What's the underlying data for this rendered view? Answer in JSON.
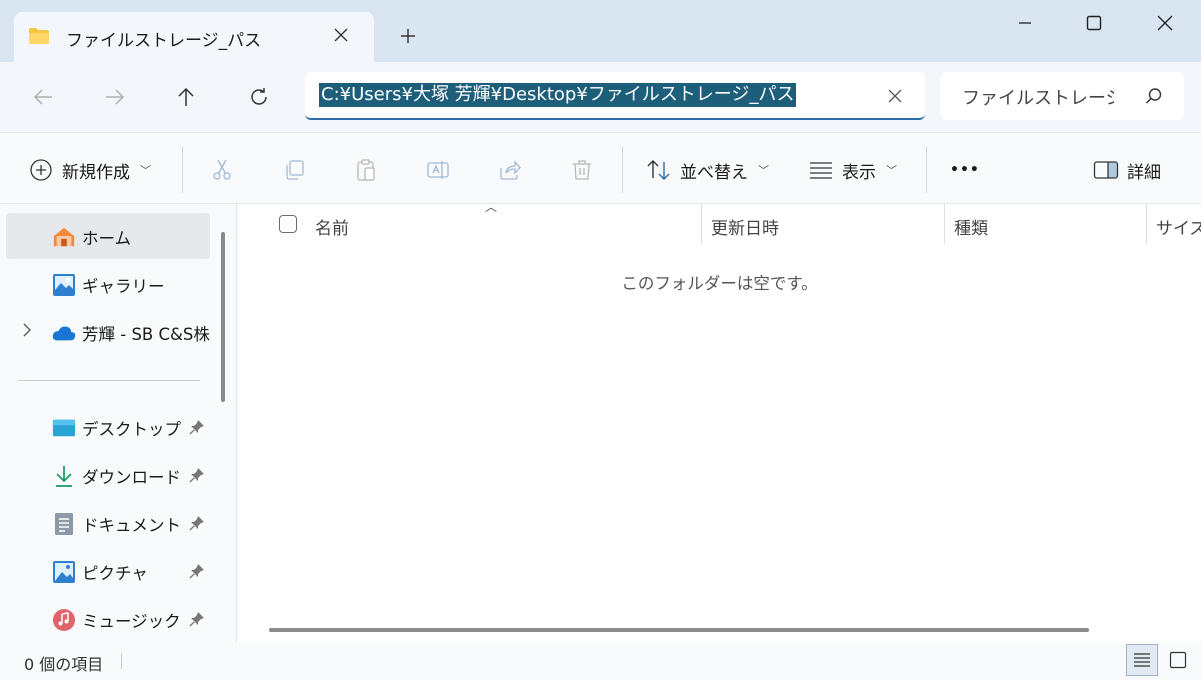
{
  "tab": {
    "title": "ファイルストレージ_パス",
    "folder_icon": "folder-icon",
    "close_icon": "close-icon"
  },
  "new_tab": {
    "icon": "plus-icon"
  },
  "window_controls": {
    "minimize": "minimize-icon",
    "maximize": "maximize-icon",
    "close": "close-icon"
  },
  "nav": {
    "back": "arrow-left-icon",
    "forward": "arrow-right-icon",
    "up": "arrow-up-icon",
    "refresh": "refresh-icon"
  },
  "address": {
    "value": "C:¥Users¥大塚 芳輝¥Desktop¥ファイルストレージ_パス"
  },
  "search": {
    "placeholder": "ファイルストレージ_パ"
  },
  "toolbar": {
    "new_label": "新規作成",
    "sort_label": "並べ替え",
    "view_label": "表示",
    "more_label": "•••",
    "details_label": "詳細"
  },
  "sidebar": {
    "items": [
      {
        "label": "ホーム",
        "icon": "home-icon"
      },
      {
        "label": "ギャラリー",
        "icon": "gallery-icon"
      },
      {
        "label": "芳輝 - SB C&S株",
        "icon": "onedrive-cloud-icon"
      }
    ],
    "pinned": [
      {
        "label": "デスクトップ",
        "icon": "desktop-icon"
      },
      {
        "label": "ダウンロード",
        "icon": "download-icon"
      },
      {
        "label": "ドキュメント",
        "icon": "document-icon"
      },
      {
        "label": "ピクチャ",
        "icon": "pictures-icon"
      },
      {
        "label": "ミュージック",
        "icon": "music-icon"
      }
    ]
  },
  "columns": {
    "name": "名前",
    "modified": "更新日時",
    "type": "種類",
    "size": "サイズ"
  },
  "empty_message": "このフォルダーは空です。",
  "status": {
    "count": "0 個の項目"
  },
  "colors": {
    "accent": "#2b6ca8",
    "selection": "#1d5e7a",
    "titlebar": "#d9e6f2"
  }
}
